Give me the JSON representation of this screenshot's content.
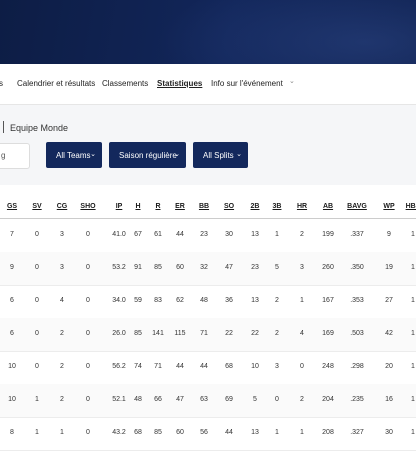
{
  "nav": {
    "items": [
      {
        "label": "s",
        "active": false
      },
      {
        "label": "Calendrier et résultats",
        "active": false
      },
      {
        "label": "Classements",
        "active": false
      },
      {
        "label": "Statistiques",
        "active": true
      },
      {
        "label": "Info sur l'événement",
        "active": false
      }
    ],
    "more": "⌄"
  },
  "breadcrumb": "Equipe Monde",
  "search": {
    "value": "g"
  },
  "filters": [
    {
      "label": "All Teams",
      "chevron": "⌄"
    },
    {
      "label": "Saison régulière",
      "chevron": "⌄"
    },
    {
      "label": "All Splits",
      "chevron": "⌄"
    }
  ],
  "table": {
    "headers": [
      "GS",
      "SV",
      "CG",
      "SHO",
      "IP",
      "H",
      "R",
      "ER",
      "BB",
      "SO",
      "2B",
      "3B",
      "HR",
      "AB",
      "BAVG",
      "WP",
      "HBP"
    ],
    "rows": [
      [
        "7",
        "0",
        "3",
        "0",
        "41.0",
        "67",
        "61",
        "44",
        "23",
        "30",
        "13",
        "1",
        "2",
        "199",
        ".337",
        "9",
        "1"
      ],
      [
        "9",
        "0",
        "3",
        "0",
        "53.2",
        "91",
        "85",
        "60",
        "32",
        "47",
        "23",
        "5",
        "3",
        "260",
        ".350",
        "19",
        "1"
      ],
      [
        "6",
        "0",
        "4",
        "0",
        "34.0",
        "59",
        "83",
        "62",
        "48",
        "36",
        "13",
        "2",
        "1",
        "167",
        ".353",
        "27",
        "1"
      ],
      [
        "6",
        "0",
        "2",
        "0",
        "26.0",
        "85",
        "141",
        "115",
        "71",
        "22",
        "22",
        "2",
        "4",
        "169",
        ".503",
        "42",
        "1"
      ],
      [
        "10",
        "0",
        "2",
        "0",
        "56.2",
        "74",
        "71",
        "44",
        "44",
        "68",
        "10",
        "3",
        "0",
        "248",
        ".298",
        "20",
        "1"
      ],
      [
        "10",
        "1",
        "2",
        "0",
        "52.1",
        "48",
        "66",
        "47",
        "63",
        "69",
        "5",
        "0",
        "2",
        "204",
        ".235",
        "16",
        "1"
      ],
      [
        "8",
        "1",
        "1",
        "0",
        "43.2",
        "68",
        "85",
        "60",
        "56",
        "44",
        "13",
        "1",
        "1",
        "208",
        ".327",
        "30",
        "1"
      ]
    ]
  }
}
